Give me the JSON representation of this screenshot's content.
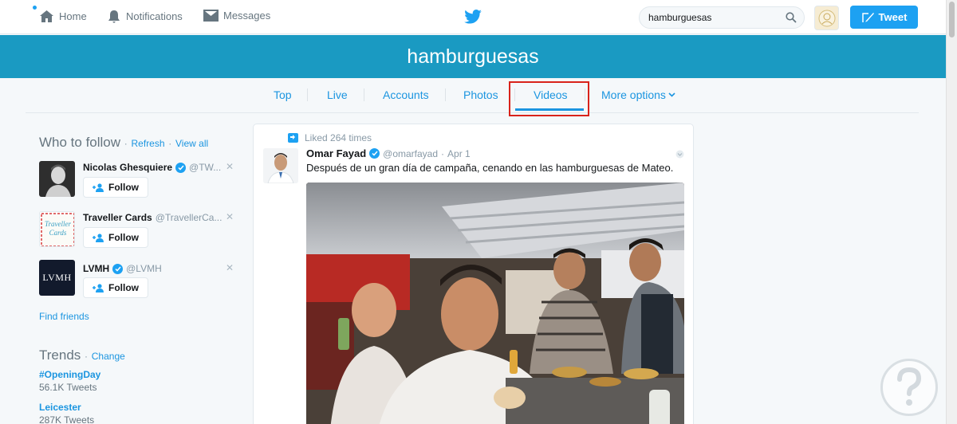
{
  "nav": {
    "home": "Home",
    "notifications": "Notifications",
    "messages": "Messages",
    "tweet_button": "Tweet"
  },
  "search": {
    "value": "hamburguesas"
  },
  "header": {
    "title": "hamburguesas"
  },
  "tabs": [
    {
      "label": "Top"
    },
    {
      "label": "Live"
    },
    {
      "label": "Accounts"
    },
    {
      "label": "Photos"
    },
    {
      "label": "Videos",
      "active": true
    },
    {
      "label": "More options"
    }
  ],
  "who_to_follow": {
    "title": "Who to follow",
    "refresh": "Refresh",
    "view_all": "View all",
    "separator": "·",
    "accounts": [
      {
        "name": "Nicolas Ghesquiere",
        "handle": "@TW...",
        "verified": true,
        "follow_label": "Follow"
      },
      {
        "name": "Traveller Cards",
        "handle": "@TravellerCa...",
        "verified": false,
        "follow_label": "Follow",
        "avatar_text": "Traveller Cards"
      },
      {
        "name": "LVMH",
        "handle": "@LVMH",
        "verified": true,
        "follow_label": "Follow",
        "avatar_text": "LVMH"
      }
    ],
    "find_friends": "Find friends"
  },
  "trends": {
    "title": "Trends",
    "change": "Change",
    "separator": "·",
    "items": [
      {
        "name": "#OpeningDay",
        "count": "56.1K Tweets"
      },
      {
        "name": "Leicester",
        "count": "287K Tweets"
      }
    ]
  },
  "tweet": {
    "liked_text": "Liked 264 times",
    "author_name": "Omar Fayad",
    "author_handle": "@omarfayad",
    "separator": "·",
    "date": "Apr 1",
    "text": "Después de un gran día de campaña, cenando en las hamburguesas de Mateo."
  },
  "colors": {
    "brand_blue": "#1da1f2",
    "header_teal": "#1a9ac2",
    "link_blue": "#1b95e0",
    "highlight_red": "#d9231b"
  }
}
